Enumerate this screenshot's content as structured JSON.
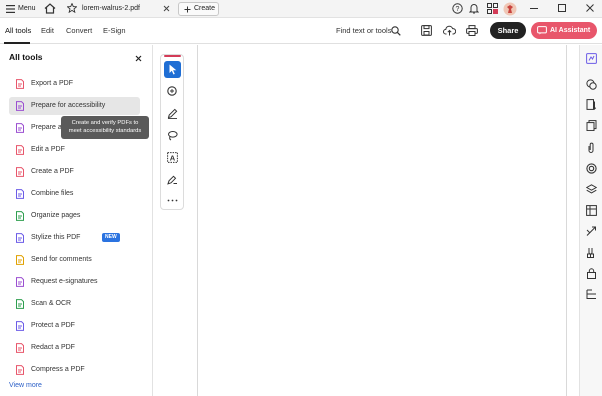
{
  "titlebar": {
    "menu_label": "Menu",
    "tab_title": "lorem-walrus-2.pdf",
    "create_label": "Create"
  },
  "menubar": {
    "tabs": [
      "All tools",
      "Edit",
      "Convert",
      "E-Sign"
    ],
    "find_label": "Find text or tools",
    "share_label": "Share",
    "ai_label": "AI Assistant"
  },
  "panel": {
    "title": "All tools",
    "items": [
      {
        "label": "Export a PDF",
        "icon": "export-pdf-icon",
        "color": "#e8566b"
      },
      {
        "label": "Prepare for accessibility",
        "icon": "accessibility-icon",
        "color": "#9b4fd1"
      },
      {
        "label": "Prepare a",
        "icon": "prepare-form-icon",
        "color": "#9b4fd1"
      },
      {
        "label": "Edit a PDF",
        "icon": "edit-pdf-icon",
        "color": "#e8566b"
      },
      {
        "label": "Create a PDF",
        "icon": "create-pdf-icon",
        "color": "#e8566b"
      },
      {
        "label": "Combine files",
        "icon": "combine-files-icon",
        "color": "#6c5ce7"
      },
      {
        "label": "Organize pages",
        "icon": "organize-pages-icon",
        "color": "#2e9e4f"
      },
      {
        "label": "Stylize this PDF",
        "icon": "stylize-icon",
        "color": "#6c5ce7",
        "badge": "NEW"
      },
      {
        "label": "Send for comments",
        "icon": "send-comments-icon",
        "color": "#e0a100"
      },
      {
        "label": "Request e-signatures",
        "icon": "esign-icon",
        "color": "#9b4fd1"
      },
      {
        "label": "Scan & OCR",
        "icon": "scan-ocr-icon",
        "color": "#2e9e4f"
      },
      {
        "label": "Protect a PDF",
        "icon": "protect-pdf-icon",
        "color": "#6c5ce7"
      },
      {
        "label": "Redact a PDF",
        "icon": "redact-pdf-icon",
        "color": "#e8566b"
      },
      {
        "label": "Compress a PDF",
        "icon": "compress-pdf-icon",
        "color": "#e8566b"
      }
    ],
    "view_more": "View more",
    "tooltip": "Create and verify PDFs to meet accessibility standards"
  },
  "colors": {
    "accent_blue": "#1f6ed4",
    "ai_button": "#e8566b",
    "share_button": "#222222"
  }
}
